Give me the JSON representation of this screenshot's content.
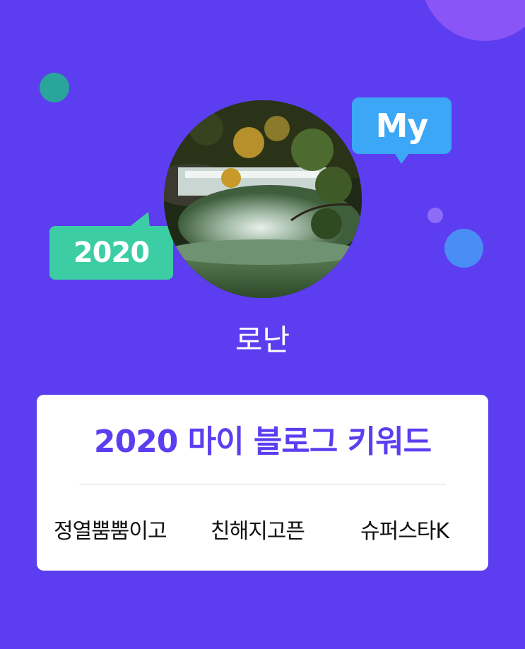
{
  "badges": {
    "my_label": "My",
    "year_label": "2020"
  },
  "profile": {
    "name": "로난",
    "avatar_image": "waterfall-forest-photo"
  },
  "card": {
    "title": "2020 마이 블로그 키워드",
    "keywords": [
      "정열뿜뿜이고",
      "친해지고픈",
      "슈퍼스타K"
    ]
  },
  "colors": {
    "background": "#5c3ef0",
    "title_accent": "#5a3ff0",
    "my_bubble": "#3ba7f6",
    "year_bubble": "#3ccda4",
    "card": "#ffffff"
  }
}
